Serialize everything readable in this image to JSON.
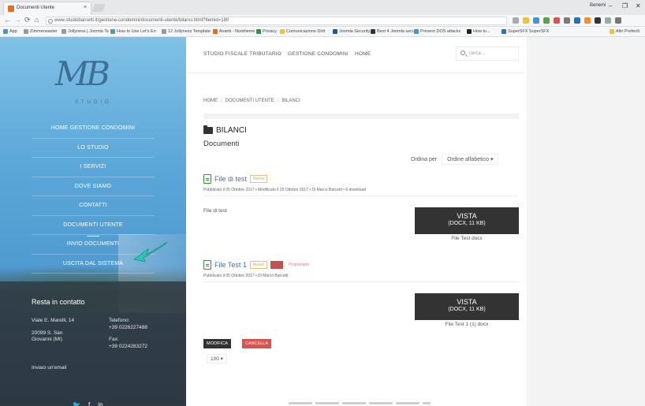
{
  "browser": {
    "tab_title": "Documenti Utente",
    "tab_close": "×",
    "url": "www.studiobarcetti.it/gestione-condomini/documenti-utente/bilanci.html?Itemid=180",
    "user": "Benemi",
    "window_controls": [
      "–",
      "❐",
      "✕"
    ],
    "bookmarks": [
      "App",
      "Zimmerwaster",
      "Jollyness | Joomla Te",
      "How to Use Let's En",
      "12 Jollyness Template",
      "Avanti - Nootheme",
      "Privacy",
      "Comunicazione Dirit",
      "Joomla Security",
      "Best 4 Joomla secure",
      "Prevent DOS attacks",
      "How to... ",
      "SuperSFX SuperSFX",
      "Altri Preferiti"
    ]
  },
  "sidebar": {
    "logo": "MB",
    "logo_sub": "STUDIO",
    "menu": [
      {
        "label": "HOME GESTIONE CONDOMINI"
      },
      {
        "label": "LO STUDIO"
      },
      {
        "label": "I SERVIZI"
      },
      {
        "label": "DOVE SIAMO"
      },
      {
        "label": "CONTATTI"
      },
      {
        "label": "DOCUMENTI UTENTE"
      },
      {
        "label": "INVIO DOCUMENTI"
      },
      {
        "label": "USCITA DAL SISTEMA"
      }
    ],
    "contact": {
      "title": "Resta in contatto",
      "address1": "Viale E. Marelli, 14",
      "address2": "20099  S. San",
      "address3": "Giovanni (MI)",
      "phone_label": "Telefono:",
      "phone": "+39 0226227488",
      "fax_label": "Fax:",
      "fax": "+39 0224283272",
      "email_link": "Inviaci un'email"
    },
    "social": [
      "🐦",
      "f",
      "in"
    ]
  },
  "main": {
    "topnav": [
      "STUDIO FISCALE TRIBUTARIO",
      "GESTIONE CONDOMINI",
      "HOME"
    ],
    "search_placeholder": "cerca...",
    "breadcrumb": [
      "HOME",
      "DOCUMENTI UTENTE",
      "BILANCI"
    ],
    "folder_title": "BILANCI",
    "documents_heading": "Documenti",
    "order_label": "Ordina per",
    "order_value": "Ordine alfabetico ▾",
    "files": [
      {
        "title": "File di test",
        "badge_new": "Nuovo",
        "meta": "Pubblicato il 05 Ottobre 2017  •  Modificato il 25 Ottobre 2017  •  Di Marco Barcetti  •  6 download",
        "description": "File di test",
        "button_line1": "VISTA",
        "button_line2": "(DOCX, 11 KB)",
        "filename": "File Test docx"
      },
      {
        "title": "File Test 1",
        "badge_new": "Nuovo",
        "badge_hot": "Hot",
        "badge_owner": "Proprietario",
        "meta": "Pubblicato il 05 Ottobre 2017  •  Di Marco Barcetti",
        "button_line1": "VISTA",
        "button_line2": "(DOCX, 11 KB)",
        "filename": "File Test 1 (1) docx"
      }
    ],
    "btn_edit": "MODIFICA",
    "btn_delete": "CANCELLA",
    "pager": "100 ▾"
  },
  "colors": {
    "sidebar_blue": "#5ba7d8",
    "dark_button": "#333333",
    "delete_red": "#d9534f",
    "arrow_teal": "#2fc4b6"
  }
}
